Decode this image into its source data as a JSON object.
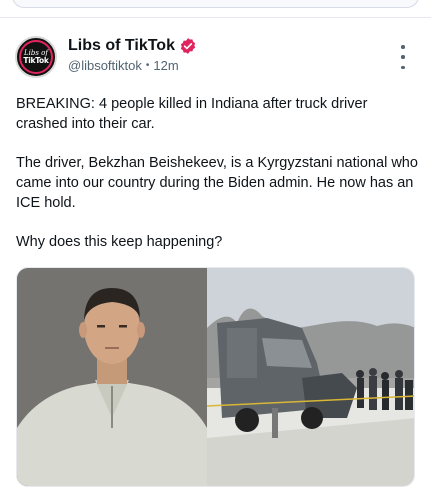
{
  "post": {
    "author": {
      "display_name": "Libs of TikTok",
      "handle": "@libsoftiktok",
      "timestamp": "12m",
      "verified": true,
      "avatar_text_line1": "Libs of",
      "avatar_text_line2": "TikTok"
    },
    "text": {
      "paragraph1": "BREAKING: 4 people killed in Indiana after truck driver crashed into their car.",
      "paragraph2": "The driver, Bekzhan Beishekeev, is a Kyrgyzstani national who came into our country during the Biden admin. He now has an ICE hold.",
      "paragraph3": "Why does this keep happening?"
    },
    "media": {
      "images": [
        "mugshot-photo",
        "truck-crash-scene-photo"
      ]
    }
  },
  "colors": {
    "verified_badge": "#e0245e",
    "text_primary": "#0f1419",
    "text_secondary": "#536471"
  },
  "icons": [
    "verified-badge-icon",
    "more-options-icon"
  ]
}
